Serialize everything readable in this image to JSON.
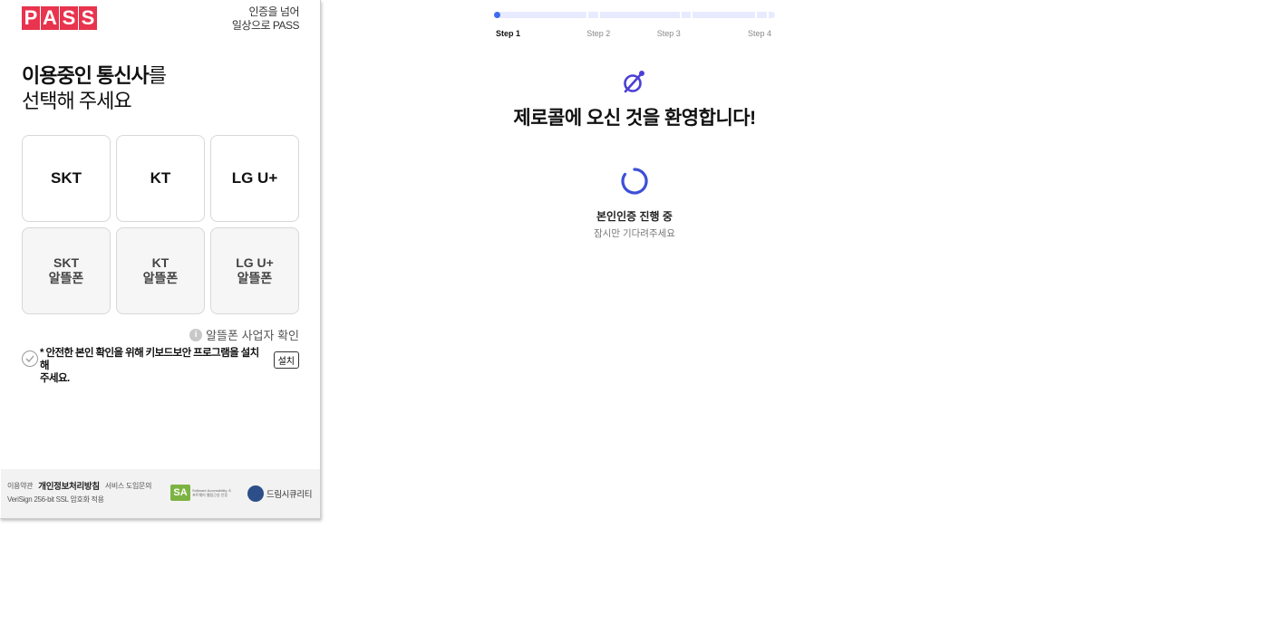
{
  "popup": {
    "logo_letters": [
      "P",
      "A",
      "S",
      "S"
    ],
    "slogan_line1": "인증을 넘어",
    "slogan_line2": "일상으로 PASS",
    "heading_bold": "이용중인 통신사",
    "heading_suffix": "를",
    "heading_line2": "선택해 주세요",
    "carriers": [
      {
        "label": "SKT"
      },
      {
        "label": "KT"
      },
      {
        "label": "LG U+"
      }
    ],
    "mvno_carriers": [
      {
        "line1": "SKT",
        "line2": "알뜰폰"
      },
      {
        "line1": "KT",
        "line2": "알뜰폰"
      },
      {
        "line1": "LG U+",
        "line2": "알뜰폰"
      }
    ],
    "mvno_check_label": "알뜰폰 사업자 확인",
    "info_glyph": "i",
    "security_line1": "* 안전한 본인 확인을 위해 키보드보안 프로그램을 설치해",
    "security_line2": "주세요.",
    "install_label": "설치",
    "footer": {
      "terms": "이용약관",
      "privacy": "개인정보처리방침",
      "inquiry": "서비스 도입문의",
      "ssl_note": "VeriSign 256-bit SSL 암호화 적용",
      "sa_mark": "SA",
      "sa_text": "Software Accessibility 소프트웨어 웹접근성 인증",
      "dream_text": "드림시큐리티"
    }
  },
  "main": {
    "steps": [
      {
        "label": "Step 1",
        "active": true
      },
      {
        "label": "Step 2",
        "active": false
      },
      {
        "label": "Step 3",
        "active": false
      },
      {
        "label": "Step 4",
        "active": false
      }
    ],
    "progress_fraction": 0.02,
    "welcome_title": "제로콜에 오신 것을 환영합니다!",
    "status_title": "본인인증 진행 중",
    "status_subtitle": "잠시만 기다려주세요",
    "accent_color": "#3d6cf0",
    "icon_color": "#4a3fd6"
  }
}
